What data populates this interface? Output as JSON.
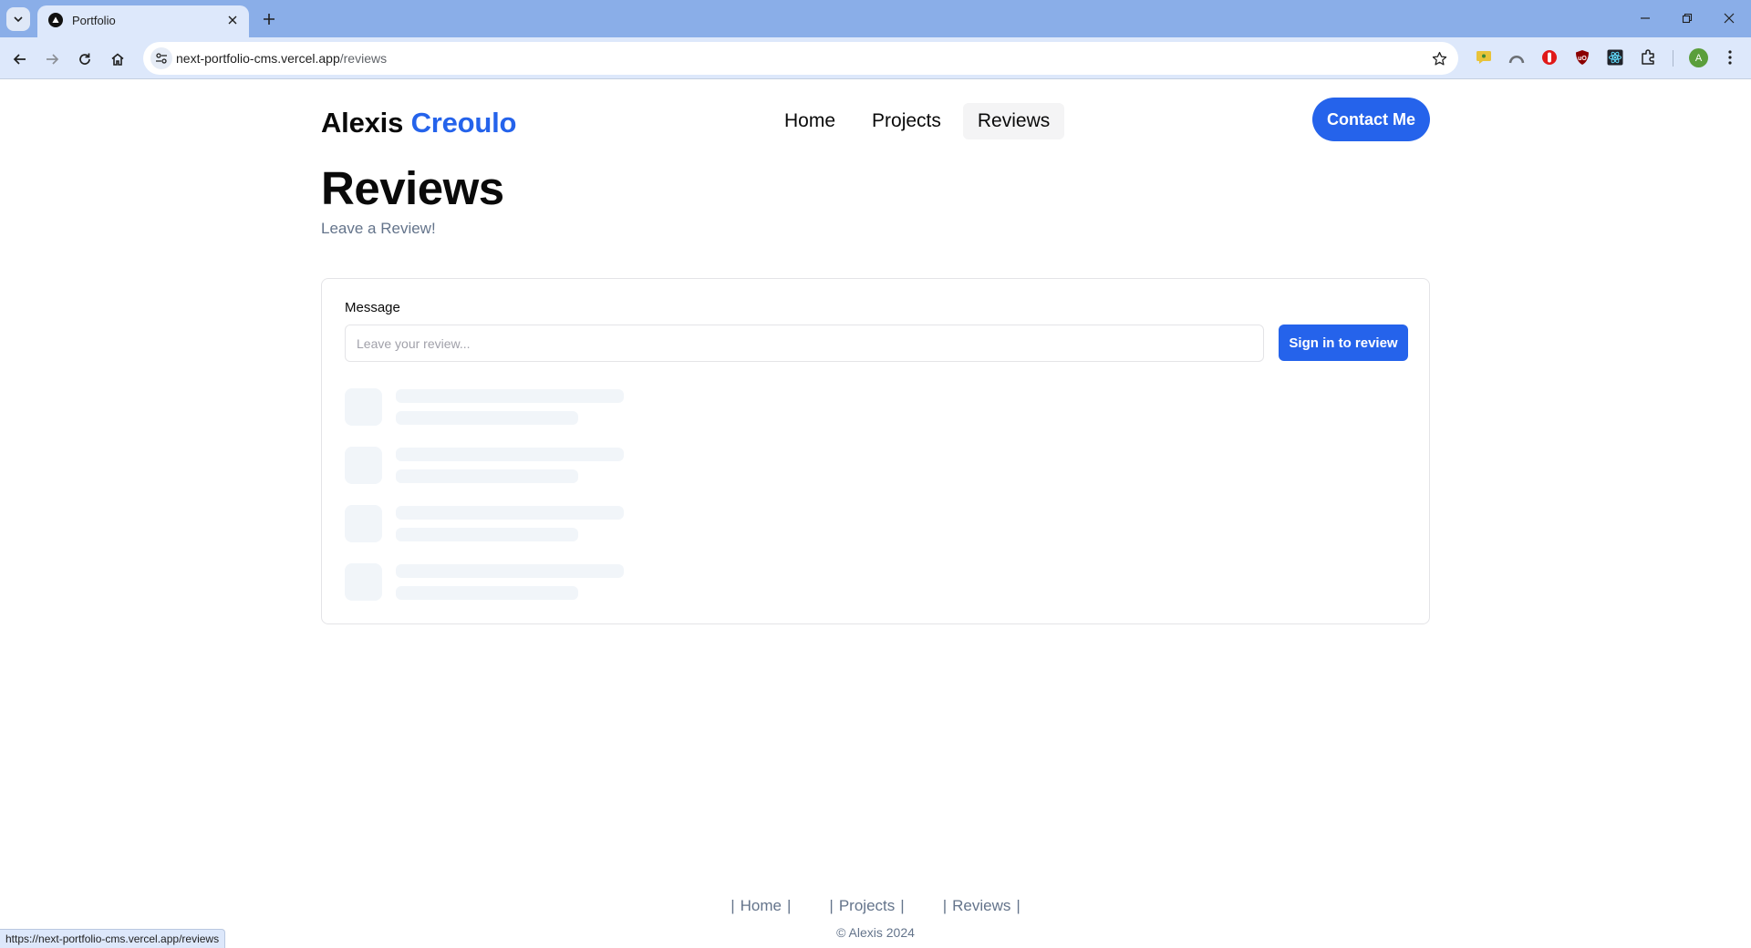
{
  "browser": {
    "tab_title": "Portfolio",
    "url_host": "next-portfolio-cms.vercel.app",
    "url_path": "/reviews",
    "status_url": "https://next-portfolio-cms.vercel.app/reviews",
    "profile_initial": "A",
    "icons": [
      "tab-list-icon",
      "close-icon",
      "new-tab-icon",
      "minimize-icon",
      "restore-icon",
      "window-close-icon",
      "back-icon",
      "forward-icon",
      "reload-icon",
      "home-icon",
      "site-info-icon",
      "bookmark-star-icon",
      "extensions-icon",
      "menu-icon"
    ]
  },
  "header": {
    "brand_first": "Alexis",
    "brand_last": "Creoulo",
    "nav": [
      "Home",
      "Projects",
      "Reviews"
    ],
    "active_nav": "Reviews",
    "contact_label": "Contact Me"
  },
  "main": {
    "title": "Reviews",
    "subtitle": "Leave a Review!",
    "form": {
      "label": "Message",
      "placeholder": "Leave your review...",
      "value": "",
      "submit_label": "Sign in to review"
    },
    "loading_placeholders": 4
  },
  "footer": {
    "links": [
      "Home",
      "Projects",
      "Reviews"
    ],
    "copyright": "© Alexis 2024"
  },
  "colors": {
    "accent": "#2563eb",
    "muted_text": "#64748b",
    "skeleton": "#f1f5f9",
    "tabstrip": "#8aaee8",
    "toolbar": "#dde8fb"
  }
}
